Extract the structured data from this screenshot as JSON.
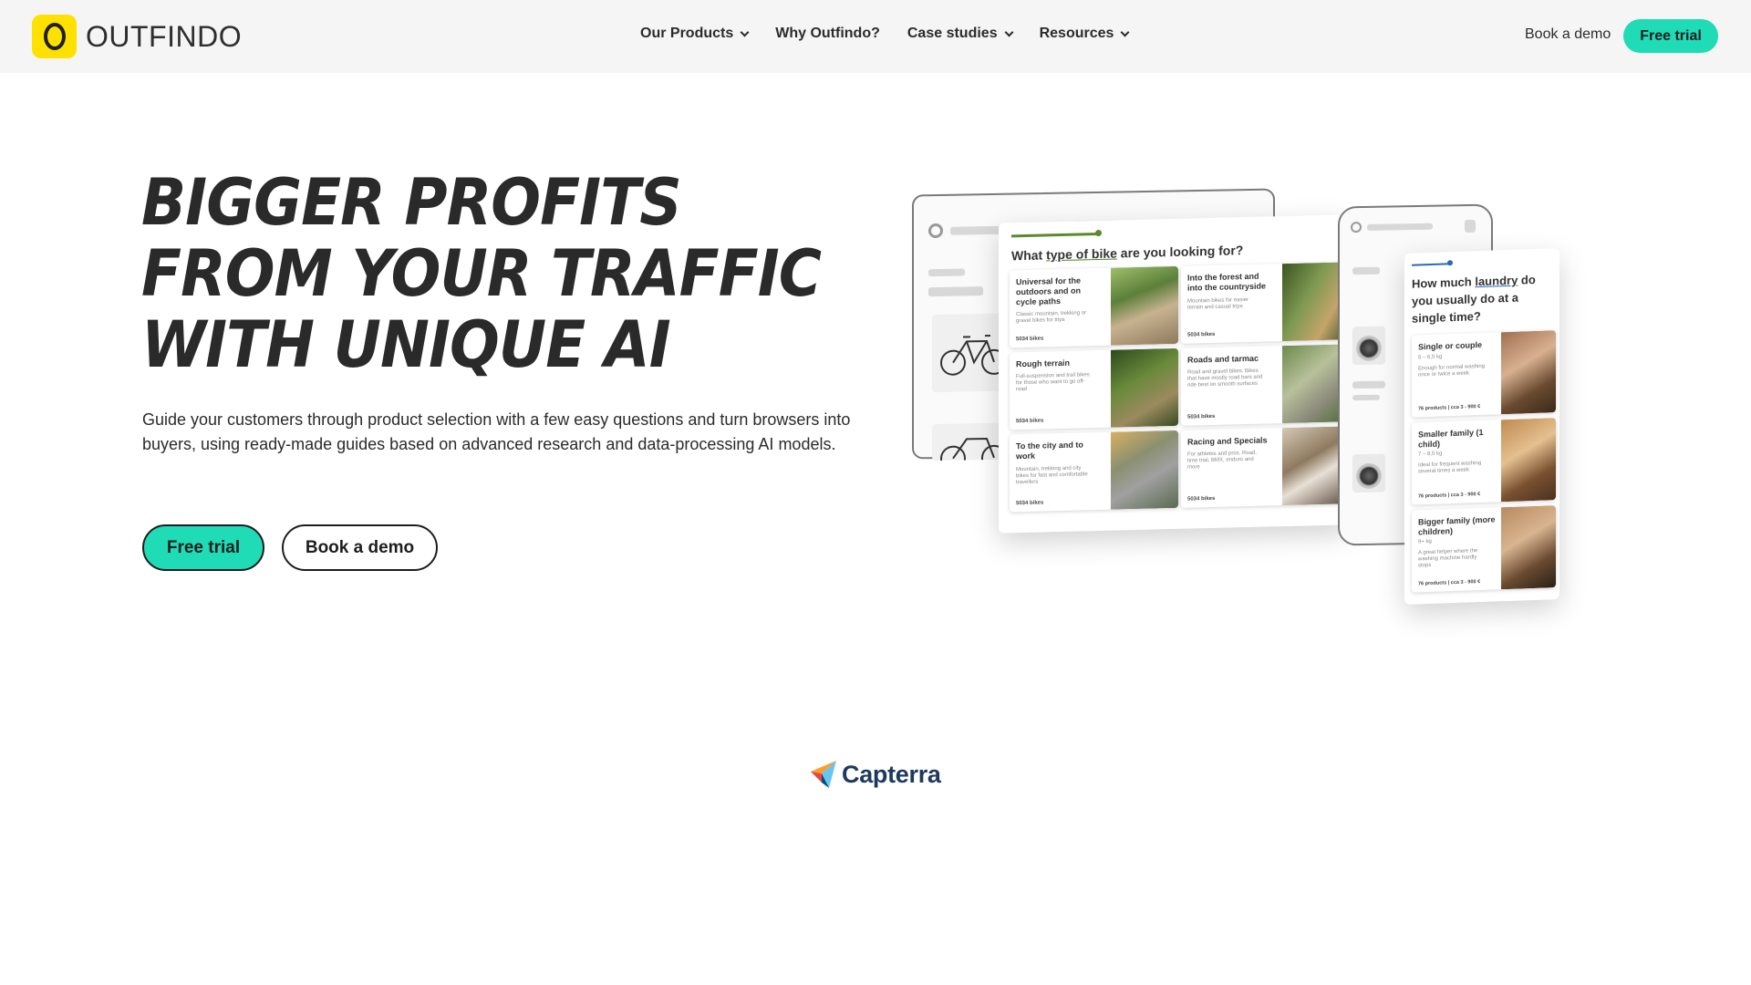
{
  "header": {
    "logo_text": "OUTFINDO",
    "nav": [
      {
        "label": "Our Products",
        "has_dropdown": true
      },
      {
        "label": "Why Outfindo?",
        "has_dropdown": false
      },
      {
        "label": "Case studies",
        "has_dropdown": true
      },
      {
        "label": "Resources",
        "has_dropdown": true
      }
    ],
    "book_demo": "Book a demo",
    "free_trial": "Free trial"
  },
  "hero": {
    "title_lines": [
      "BIGGER PROFITS",
      "FROM YOUR TRAFFIC",
      "WITH UNIQUE AI"
    ],
    "subtitle": "Guide your customers through product selection with a few easy questions and turn browsers into buyers, using ready-made guides based on advanced research and data-processing AI models.",
    "free_trial": "Free trial",
    "book_demo": "Book a demo"
  },
  "mockup": {
    "desktop_question_pre": "What ",
    "desktop_question_keyword": "type of bike",
    "desktop_question_post": " are you looking for?",
    "desktop_options": [
      {
        "title": "Universal for the outdoors and on cycle paths",
        "desc": "Classic mountain, trekking or gravel bikes for trips",
        "count": "5034 bikes"
      },
      {
        "title": "Into the forest and into the countryside",
        "desc": "Mountain bikes for easier terrain and casual trips",
        "count": "5034 bikes"
      },
      {
        "title": "Rough terrain",
        "desc": "Full-suspension and trail bikes for those who want to go off-road",
        "count": "5034 bikes"
      },
      {
        "title": "Roads and tarmac",
        "desc": "Road and gravel bikes. Bikes that have mostly road bars and ride best on smooth surfaces",
        "count": "5034 bikes"
      },
      {
        "title": "To the city and to work",
        "desc": "Mountain, trekking and city bikes for fast and comfortable travellers",
        "count": "5034 bikes"
      },
      {
        "title": "Racing and Specials",
        "desc": "For athletes and pros. Road, time trial, BMX, enduro and more",
        "count": "5034 bikes"
      }
    ],
    "mobile_question_pre": "How much ",
    "mobile_question_keyword": "laundry",
    "mobile_question_post": " do you usually do at a single time?",
    "mobile_options": [
      {
        "title": "Single or couple",
        "weight": "5 – 6,5 kg",
        "desc": "Enough for normal washing once or twice a week",
        "count": "76 products | cca 3 - 900 €"
      },
      {
        "title": "Smaller family (1 child)",
        "weight": "7 – 8,5 kg",
        "desc": "Ideal for frequent washing several times a week",
        "count": "76 products | cca 3 - 900 €"
      },
      {
        "title": "Bigger family (more children)",
        "weight": "9+ kg",
        "desc": "A great helper where the washing machine hardly stops",
        "count": "76 products | cca 3 - 900 €"
      }
    ]
  },
  "capterra": {
    "label": "Capterra"
  },
  "colors": {
    "brand_yellow": "#ffe100",
    "accent_teal": "#1fdcb7",
    "text_dark": "#2b2b2b",
    "capterra_navy": "#1d3a5e"
  }
}
